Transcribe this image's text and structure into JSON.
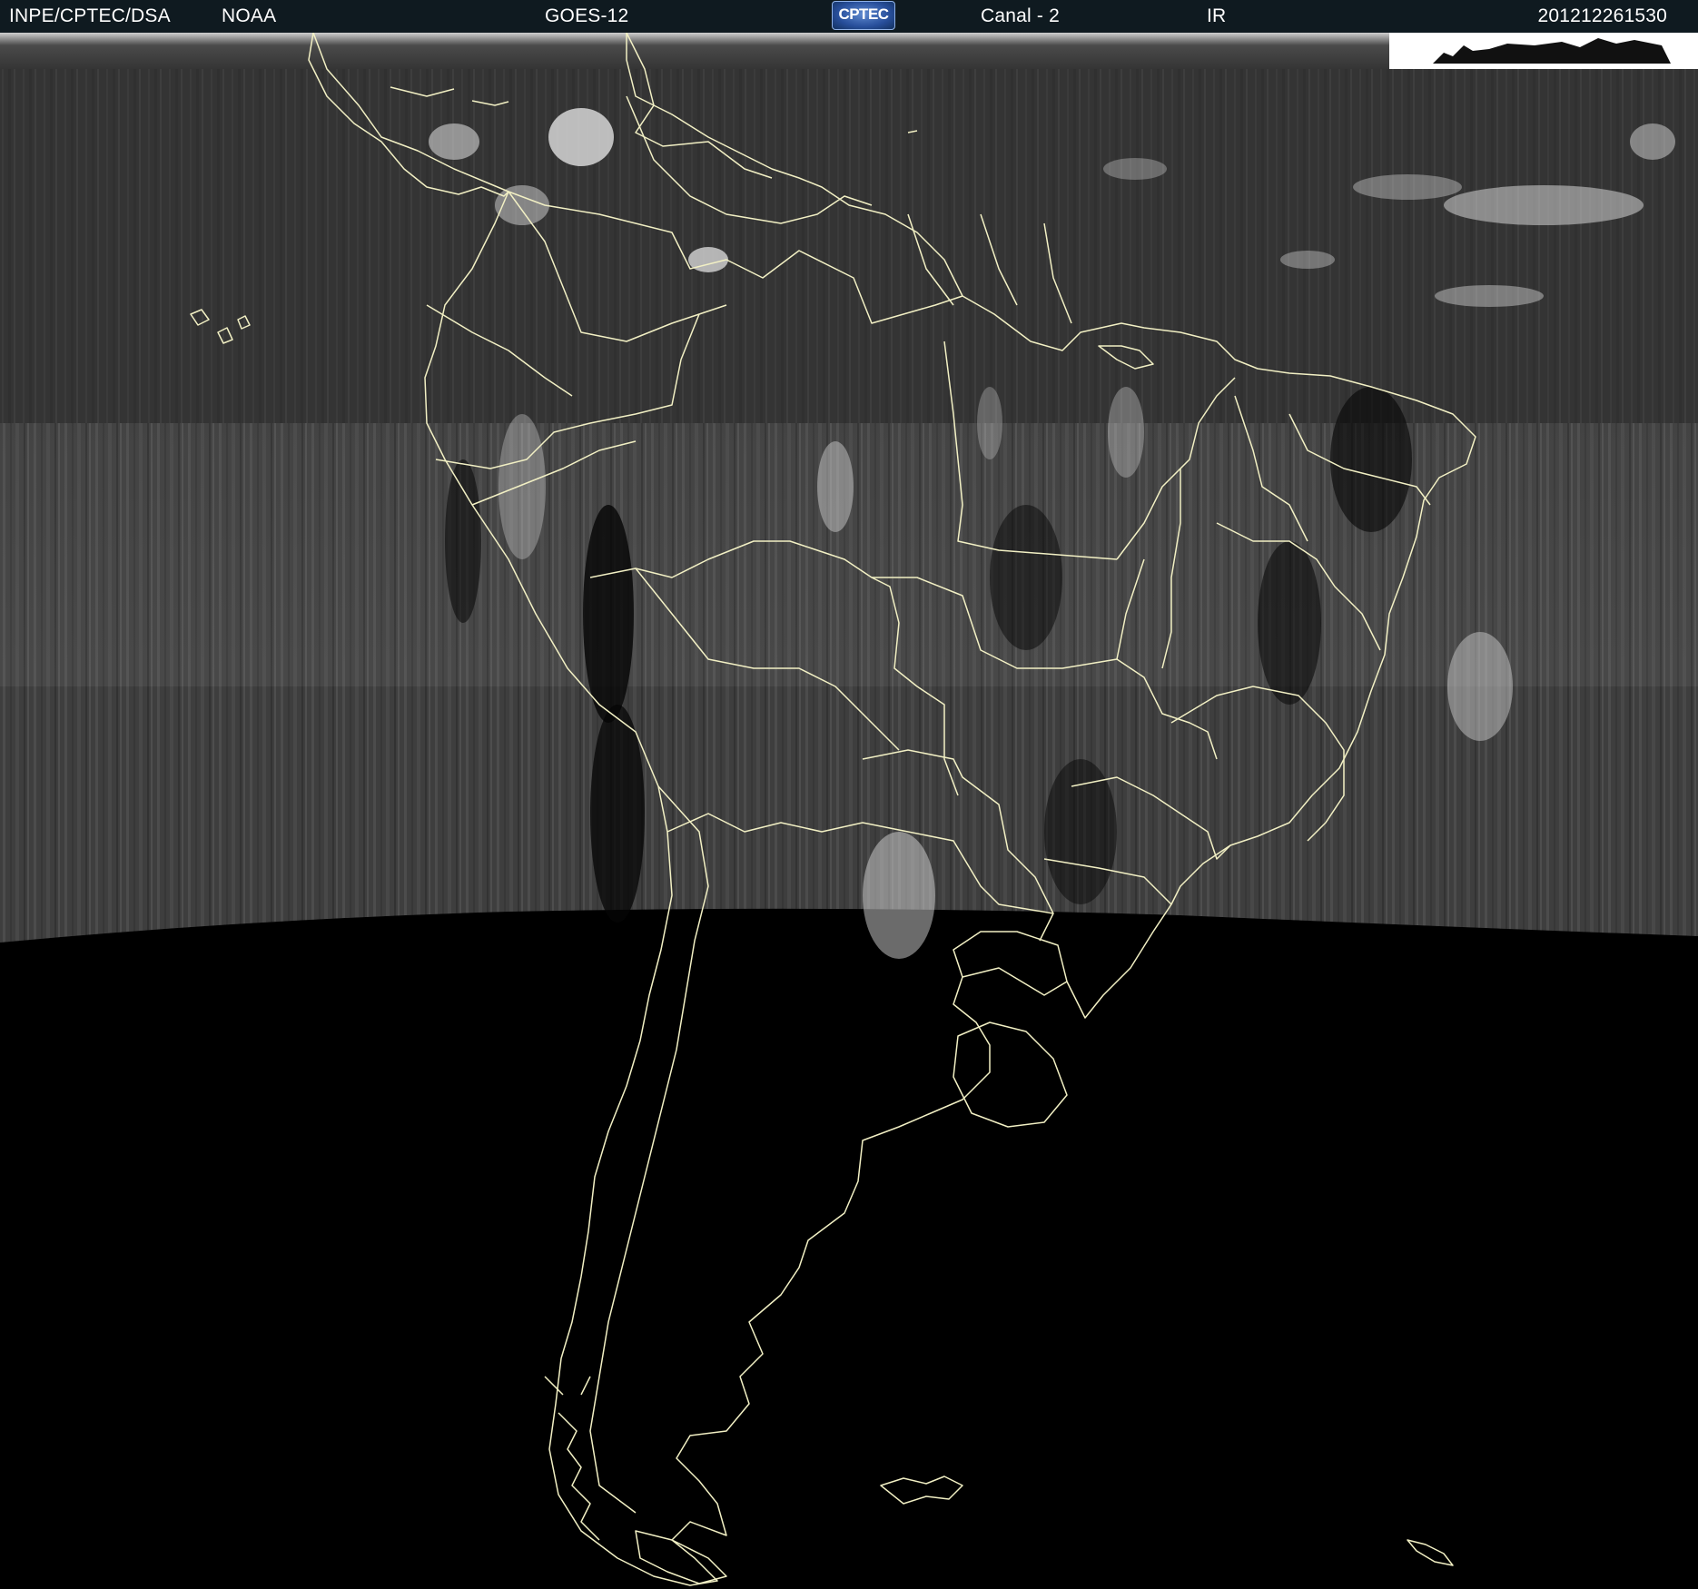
{
  "header": {
    "agency": "INPE/CPTEC/DSA",
    "provider": "NOAA",
    "satellite": "GOES-12",
    "logo_text": "CPTEC",
    "channel": "Canal - 2",
    "band": "IR",
    "datetime": "201212261530"
  },
  "colors": {
    "header_bg": "#0f1a20",
    "header_text": "#ffffff",
    "map_outline": "#f2f0c4",
    "space_background": "#000000",
    "logo_blue": "#274e9a"
  },
  "icons": {
    "logo": "cptec-logo"
  }
}
